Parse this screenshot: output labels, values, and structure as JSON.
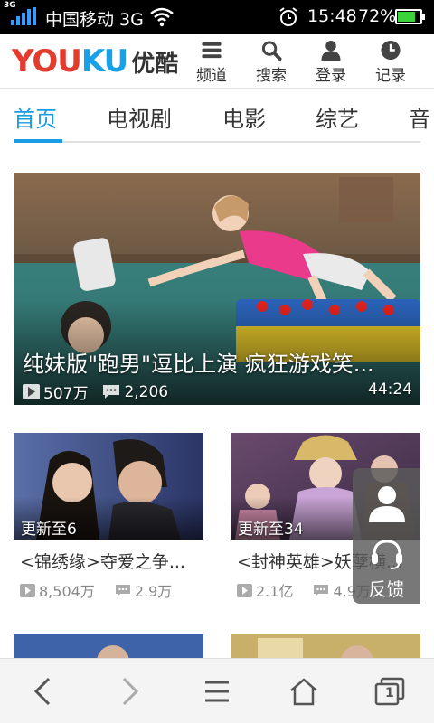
{
  "status_bar": {
    "network_small": "3G",
    "carrier": "中国移动 3G",
    "time": "15:48",
    "battery_percent": "72%",
    "battery_level": 0.72,
    "icons": [
      "signal-icon",
      "wifi-icon",
      "alarm-icon",
      "battery-icon"
    ]
  },
  "header": {
    "logo_you": "YOU",
    "logo_ku": "KU",
    "logo_cn": "优酷",
    "buttons": [
      {
        "label": "频道",
        "icon": "menu-icon"
      },
      {
        "label": "搜索",
        "icon": "search-icon"
      },
      {
        "label": "登录",
        "icon": "user-icon"
      },
      {
        "label": "记录",
        "icon": "history-clock-icon"
      }
    ]
  },
  "tabs": [
    {
      "label": "首页",
      "active": true
    },
    {
      "label": "电视剧",
      "active": false
    },
    {
      "label": "电影",
      "active": false
    },
    {
      "label": "综艺",
      "active": false
    },
    {
      "label": "音",
      "active": false
    }
  ],
  "featured": {
    "caption": "纯妹版\"跑男\"逗比上演 疯狂游戏笑...",
    "views": "507万",
    "comments": "2,206",
    "duration": "44:24"
  },
  "cards": [
    {
      "update": "更新至6",
      "title": "<锦绣缘>夺爱之争...",
      "views": "8,504万",
      "comments": "2.9万"
    },
    {
      "update": "更新至34",
      "title": "<封神英雄>妖孽横...",
      "views": "2.1亿",
      "comments": "4.9万"
    }
  ],
  "feedback": {
    "label": "反馈",
    "icon": "headset-icon"
  },
  "bottom_nav": [
    {
      "icon": "back-arrow-icon"
    },
    {
      "icon": "forward-arrow-icon"
    },
    {
      "icon": "menu-icon"
    },
    {
      "icon": "home-icon"
    },
    {
      "icon": "windows-icon",
      "count": "1"
    }
  ],
  "colors": {
    "accent": "#1a9be6",
    "logo_red": "#e43b2f",
    "logo_blue": "#18a0e8"
  }
}
